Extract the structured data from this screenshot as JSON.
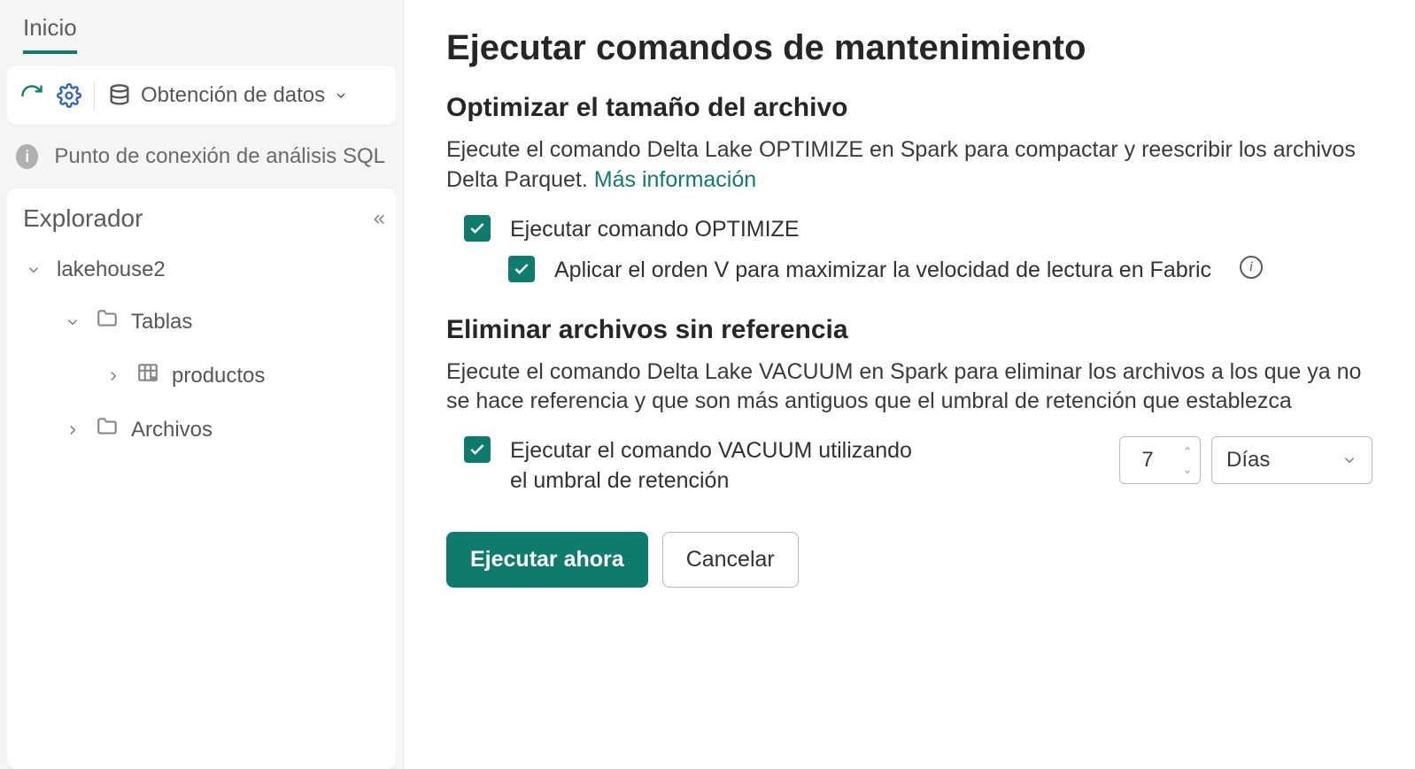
{
  "tabs": {
    "home_label": "Inicio"
  },
  "toolbar": {
    "get_data_label": "Obtención de datos"
  },
  "banner": {
    "info_text": "Punto de conexión de análisis SQL par"
  },
  "explorer": {
    "title": "Explorador",
    "root_label": "lakehouse2",
    "tables_label": "Tablas",
    "item_productos": "productos",
    "files_label": "Archivos"
  },
  "panel": {
    "title": "Ejecutar comandos de mantenimiento",
    "optimize": {
      "heading": "Optimizar el tamaño del archivo",
      "desc_before_link": "Ejecute el comando Delta Lake OPTIMIZE en Spark para compactar y reescribir los archivos Delta Parquet. ",
      "link_text": "Más información",
      "check_optimize": "Ejecutar comando OPTIMIZE",
      "check_vorder": "Aplicar el orden V para maximizar la velocidad de lectura en Fabric"
    },
    "vacuum": {
      "heading": "Eliminar archivos sin referencia",
      "desc": "Ejecute el comando Delta Lake VACUUM en Spark para eliminar los archivos a los que ya no se hace referencia y que son más antiguos que el umbral de retención que establezca",
      "check_label": "Ejecutar el comando VACUUM utilizando el umbral de retención",
      "value": "7",
      "unit_selected": "Días"
    },
    "buttons": {
      "run_now": "Ejecutar ahora",
      "cancel": "Cancelar"
    }
  }
}
